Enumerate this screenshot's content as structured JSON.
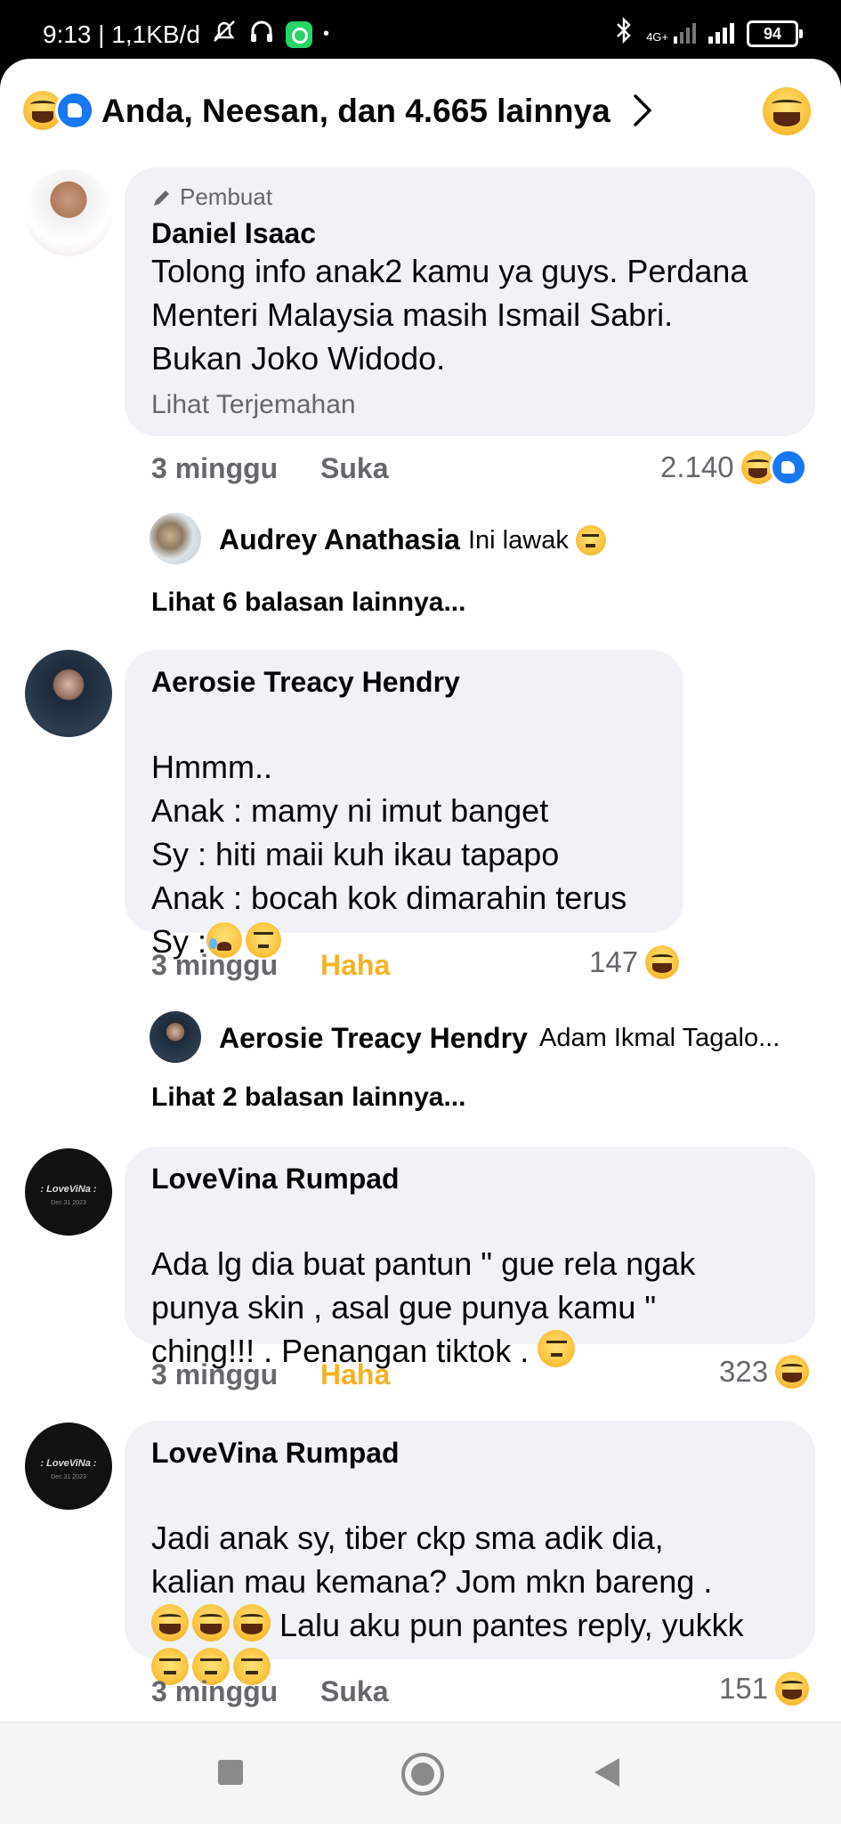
{
  "status_bar": {
    "time_speed": "9:13 | 1,1KB/d",
    "network_label": "4G+",
    "battery": "94"
  },
  "reactions": {
    "summary": "Anda, Neesan, dan 4.665 lainnya",
    "icons": [
      "haha-icon",
      "like-icon"
    ]
  },
  "comments": [
    {
      "badge": "Pembuat",
      "name": "Daniel Isaac",
      "text": "Tolong info anak2 kamu ya guys. Perdana\nMenteri Malaysia masih Ismail Sabri.\nBukan Joko Widodo.",
      "translate": "Lihat Terjemahan",
      "time": "3 minggu",
      "action": "Suka",
      "count": "2.140",
      "reply": {
        "name": "Audrey Anathasia",
        "text": "Ini lawak"
      },
      "more": "Lihat 6 balasan lainnya..."
    },
    {
      "name": "Aerosie Treacy Hendry",
      "text": "Hmmm..\nAnak : mamy ni imut banget\nSy : hiti maii kuh ikau tapapo\nAnak : bocah kok dimarahin terus\nSy :",
      "time": "3 minggu",
      "action": "Haha",
      "count": "147",
      "reply": {
        "name": "Aerosie Treacy Hendry",
        "text": "Adam Ikmal  Tagalo..."
      },
      "more": "Lihat 2 balasan lainnya..."
    },
    {
      "name": "LoveVina Rumpad",
      "text": "Ada lg dia buat pantun \" gue rela ngak\npunya skin , asal gue punya kamu \"\nching!!! . Penangan tiktok .",
      "time": "3 minggu",
      "action": "Haha",
      "count": "323"
    },
    {
      "name": "LoveVina Rumpad",
      "text": "Jadi anak sy, tiber ckp sma adik dia,\nkalian mau kemana? Jom mkn bareng .\n",
      "text_tail": " Lalu aku pun pantes reply, yukkk",
      "time": "3 minggu",
      "action": "Suka",
      "count": "151"
    }
  ],
  "avatar_text": {
    "love_name": ": LoveViNa :",
    "love_date": "Dec.31 2023"
  },
  "colors": {
    "accent_blue": "#1877f2",
    "haha_yellow": "#f7b125",
    "bubble_gray": "#f0f2f5",
    "meta_gray": "#65676b"
  }
}
